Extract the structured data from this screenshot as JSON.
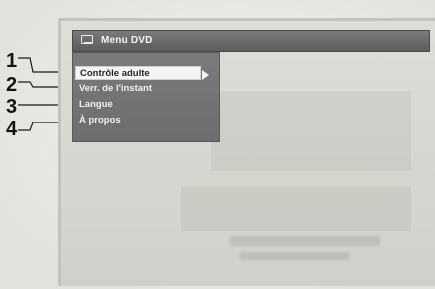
{
  "menu": {
    "title": "Menu DVD",
    "items": [
      {
        "label": "Contrôle adulte",
        "selected": true,
        "has_submenu": true
      },
      {
        "label": "Verr. de l'instant",
        "selected": false,
        "has_submenu": false
      },
      {
        "label": "Langue",
        "selected": false,
        "has_submenu": false
      },
      {
        "label": "À propos",
        "selected": false,
        "has_submenu": false
      }
    ]
  },
  "callouts": [
    "1",
    "2",
    "3",
    "4"
  ],
  "icons": {
    "title": "disc-menu-icon",
    "submenu": "arrow-right-icon"
  },
  "colors": {
    "panel": "#6f6f6f",
    "title_bar": "#606060",
    "selected_bg": "#f4f4f4",
    "screen_bg": "#d9d8d2"
  }
}
